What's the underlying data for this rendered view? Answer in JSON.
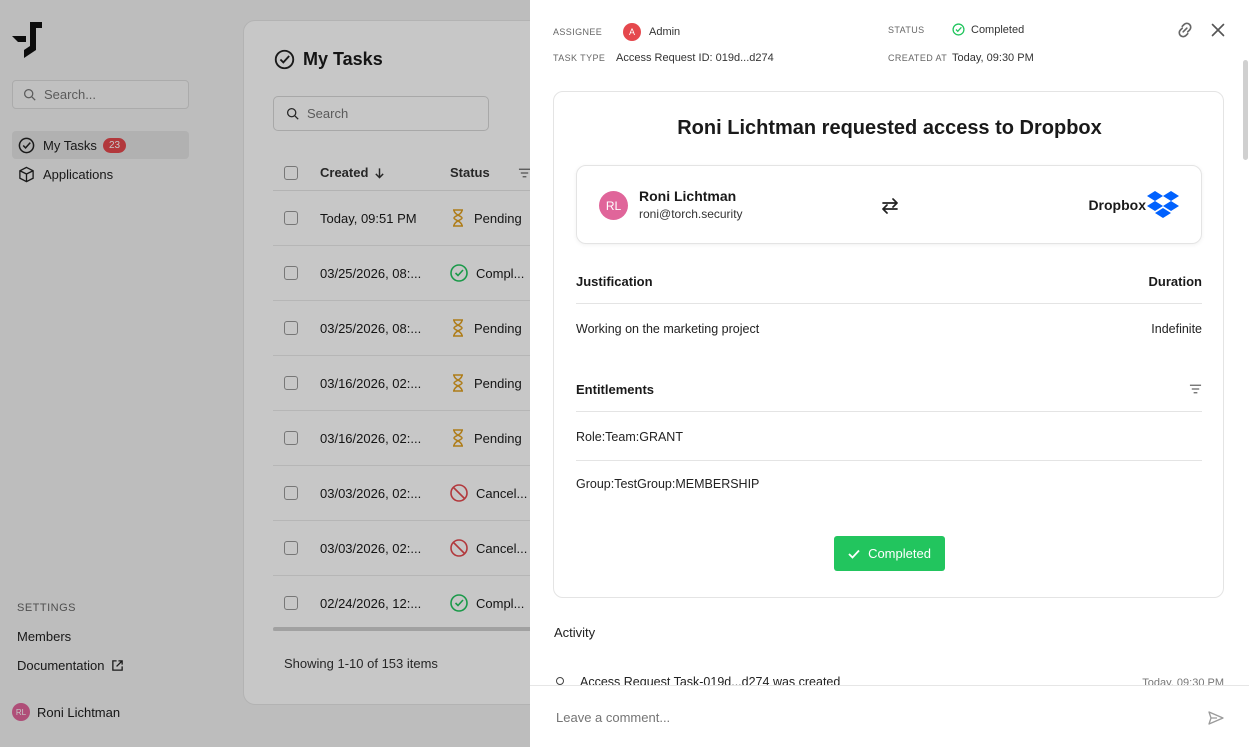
{
  "sidebar": {
    "search_placeholder": "Search...",
    "items": [
      {
        "label": "My Tasks",
        "badge": "23"
      },
      {
        "label": "Applications"
      }
    ],
    "settings_heading": "SETTINGS",
    "settings_links": [
      {
        "label": "Members"
      },
      {
        "label": "Documentation"
      }
    ],
    "user": {
      "initials": "RL",
      "name": "Roni Lichtman"
    }
  },
  "main": {
    "title": "My Tasks",
    "search_placeholder": "Search",
    "columns": {
      "created": "Created",
      "status": "Status"
    },
    "rows": [
      {
        "date": "Today, 09:51 PM",
        "status": "Pending",
        "status_kind": "pending"
      },
      {
        "date": "03/25/2026, 08:...",
        "status": "Compl...",
        "status_kind": "completed"
      },
      {
        "date": "03/25/2026, 08:...",
        "status": "Pending",
        "status_kind": "pending"
      },
      {
        "date": "03/16/2026, 02:...",
        "status": "Pending",
        "status_kind": "pending"
      },
      {
        "date": "03/16/2026, 02:...",
        "status": "Pending",
        "status_kind": "pending"
      },
      {
        "date": "03/03/2026, 02:...",
        "status": "Cancel...",
        "status_kind": "cancelled"
      },
      {
        "date": "03/03/2026, 02:...",
        "status": "Cancel...",
        "status_kind": "cancelled"
      },
      {
        "date": "02/24/2026, 12:...",
        "status": "Compl...",
        "status_kind": "completed"
      }
    ],
    "showing": "Showing 1-10 of 153 items"
  },
  "drawer": {
    "assignee_label": "ASSIGNEE",
    "assignee_initial": "A",
    "assignee_value": "Admin",
    "status_label": "STATUS",
    "status_value": "Completed",
    "task_type_label": "TASK TYPE",
    "task_type_value": "Access Request ID: 019d...d274",
    "created_at_label": "CREATED AT",
    "created_at_value": "Today, 09:30 PM",
    "title": "Roni Lichtman requested access to Dropbox",
    "requester": {
      "initials": "RL",
      "name": "Roni Lichtman",
      "email": "roni@torch.security"
    },
    "app_name": "Dropbox",
    "justification_label": "Justification",
    "duration_label": "Duration",
    "justification_value": "Working on the marketing project",
    "duration_value": "Indefinite",
    "entitlements_label": "Entitlements",
    "entitlements": [
      "Role:Team:GRANT",
      "Group:TestGroup:MEMBERSHIP"
    ],
    "completed_button": "Completed",
    "activity_label": "Activity",
    "activity_entry": "Access Request Task-019d...d274 was created",
    "activity_time": "Today, 09:30 PM",
    "comment_placeholder": "Leave a comment..."
  },
  "colors": {
    "success": "#22c55e",
    "danger": "#e5484d",
    "pending": "#e0a020",
    "avatar": "#e0659a",
    "dropbox": "#0061fe"
  },
  "icons": [
    "logo-icon",
    "search-icon",
    "check-circle-icon",
    "box-icon",
    "external-link-icon",
    "sort-down-icon",
    "filter-icon",
    "hourglass-icon",
    "cancel-icon",
    "link-icon",
    "close-icon",
    "swap-icon",
    "dropbox-icon",
    "check-icon",
    "send-icon"
  ]
}
